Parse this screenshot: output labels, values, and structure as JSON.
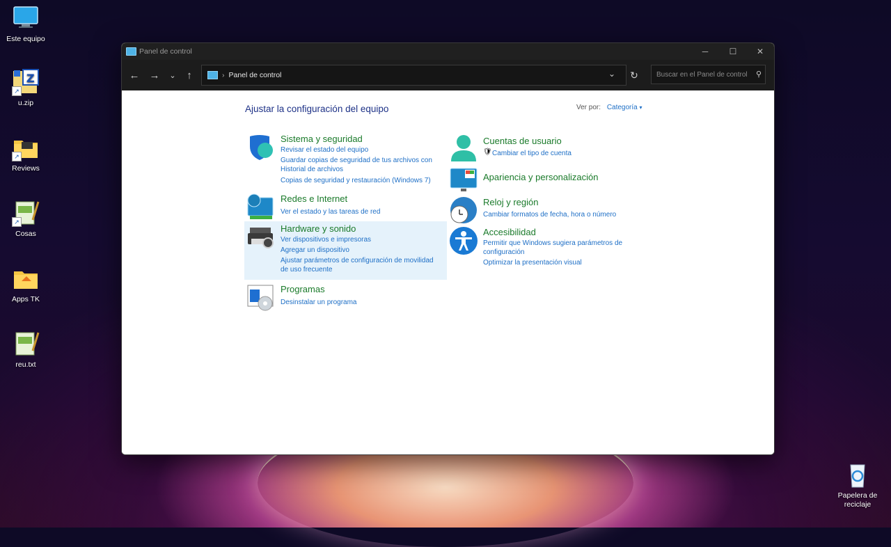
{
  "desktop": {
    "icons": [
      {
        "label": "Este equipo"
      },
      {
        "label": "u.zip"
      },
      {
        "label": "Reviews"
      },
      {
        "label": "Cosas"
      },
      {
        "label": "Apps TK"
      },
      {
        "label": "reu.txt"
      },
      {
        "label": "Papelera de reciclaje"
      }
    ]
  },
  "window": {
    "title": "Panel de control",
    "address": {
      "crumb": "Panel de control"
    },
    "search": {
      "placeholder": "Buscar en el Panel de control"
    }
  },
  "content": {
    "heading": "Ajustar la configuración del equipo",
    "view_by_label": "Ver por:",
    "view_by_value": "Categoría",
    "left": [
      {
        "title": "Sistema y seguridad",
        "links": [
          "Revisar el estado del equipo",
          "Guardar copias de seguridad de tus archivos con Historial de archivos",
          "Copias de seguridad y restauración (Windows 7)"
        ]
      },
      {
        "title": "Redes e Internet",
        "links": [
          "Ver el estado y las tareas de red"
        ]
      },
      {
        "title": "Hardware y sonido",
        "links": [
          "Ver dispositivos e impresoras",
          "Agregar un dispositivo",
          "Ajustar parámetros de configuración de movilidad de uso frecuente"
        ]
      },
      {
        "title": "Programas",
        "links": [
          "Desinstalar un programa"
        ]
      }
    ],
    "right": [
      {
        "title": "Cuentas de usuario",
        "links": [
          "Cambiar el tipo de cuenta"
        ]
      },
      {
        "title": "Apariencia y personalización",
        "links": []
      },
      {
        "title": "Reloj y región",
        "links": [
          "Cambiar formatos de fecha, hora o número"
        ]
      },
      {
        "title": "Accesibilidad",
        "links": [
          "Permitir que Windows sugiera parámetros de configuración",
          "Optimizar la presentación visual"
        ]
      }
    ]
  },
  "colors": {
    "heading": "#1e3287",
    "category_title": "#1a7a2a",
    "link": "#1e6fc6",
    "hover": "#e5f2fb"
  }
}
